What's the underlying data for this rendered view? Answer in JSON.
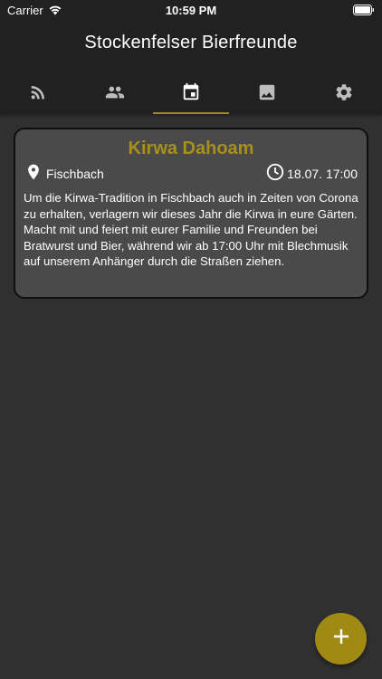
{
  "status_bar": {
    "carrier": "Carrier",
    "time": "10:59 PM",
    "wifi_icon": "wifi-icon",
    "battery_icon": "battery-icon"
  },
  "app_bar": {
    "title": "Stockenfelser Bierfreunde",
    "tabs": [
      {
        "icon": "rss-feed-icon",
        "active": false
      },
      {
        "icon": "people-icon",
        "active": false
      },
      {
        "icon": "calendar-icon",
        "active": true
      },
      {
        "icon": "image-icon",
        "active": false
      },
      {
        "icon": "gear-icon",
        "active": false
      }
    ]
  },
  "events": [
    {
      "title": "Kirwa Dahoam",
      "location": "Fischbach",
      "datetime": "18.07. 17:00",
      "description": "Um die Kirwa-Tradition in Fischbach auch in Zeiten von Corona zu erhalten, verlagern wir dieses Jahr die Kirwa in eure Gärten. Macht mit und feiert mit eurer Familie und Freunden bei Bratwurst und Bier, während wir ab 17:00 Uhr mit Blechmusik auf unserem Anhänger durch die Straßen ziehen."
    }
  ],
  "fab": {
    "icon": "plus-icon"
  },
  "colors": {
    "accent": "#a08a14",
    "card_title": "#a8901a",
    "background": "#303030",
    "app_bar": "#212121",
    "card": "#4a4a4a"
  }
}
